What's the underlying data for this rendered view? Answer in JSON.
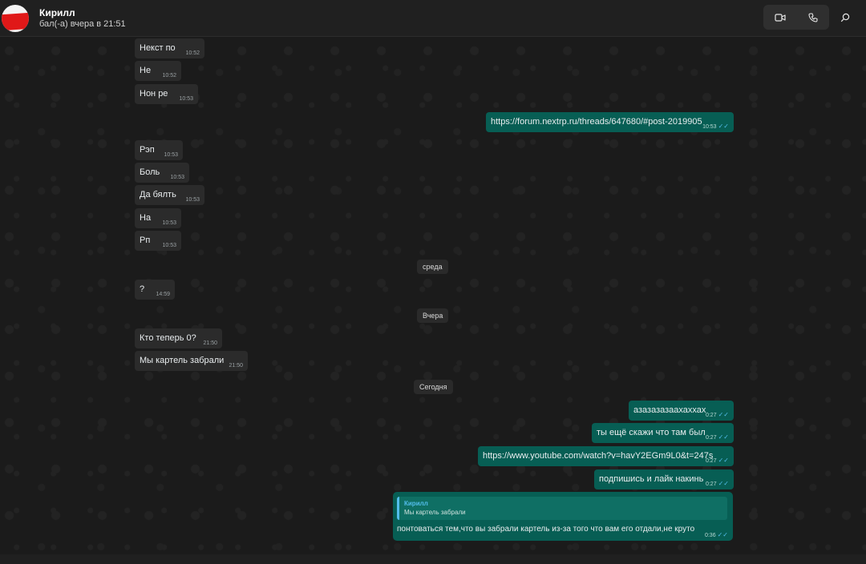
{
  "header": {
    "contact_name": "Кирилл",
    "status": "бал(-а) вчера в 21:51",
    "video_icon": "video-camera-icon",
    "call_icon": "phone-icon",
    "search_icon": "search-icon"
  },
  "separators": [
    "среда",
    "Вчера",
    "Сегодня"
  ],
  "messages": [
    {
      "text": "Некст по",
      "time": "10:52"
    },
    {
      "text": "Не",
      "time": "10:52"
    },
    {
      "text": "Нон ре",
      "time": "10:53"
    },
    {
      "text": "https://forum.nextrp.ru/threads/647680/#post-2019905",
      "time": "10:53"
    },
    {
      "text": "Рэп",
      "time": "10:53"
    },
    {
      "text": "Боль",
      "time": "10:53"
    },
    {
      "text": "Да бялть",
      "time": "10:53"
    },
    {
      "text": "На",
      "time": "10:53"
    },
    {
      "text": "Рп",
      "time": "10:53"
    },
    {
      "text": "?",
      "time": "14:59"
    },
    {
      "text": "Кто теперь 0?",
      "time": "21:50"
    },
    {
      "text": "Мы картель забрали",
      "time": "21:50"
    },
    {
      "text": "азазазазаахаххах",
      "time": "0:27"
    },
    {
      "text": "ты ещё скажи что там был",
      "time": "0:27"
    },
    {
      "text": "https://www.youtube.com/watch?v=havY2EGm9L0&t=247s",
      "time": "0:27"
    },
    {
      "text": "подпишись и лайк накинь",
      "time": "0:27"
    }
  ],
  "reply": {
    "quote_author": "Кирилл",
    "quote_text": "Мы картель забрали",
    "text": "понтоваться тем,что вы забрали картель из-за того что вам его отдали,не круто",
    "time": "0:36"
  },
  "colors": {
    "incoming_bubble": "#2b2b2b",
    "outgoing_bubble": "#075e54",
    "read_ticks": "#53bdeb",
    "background": "#1b1b1b"
  }
}
